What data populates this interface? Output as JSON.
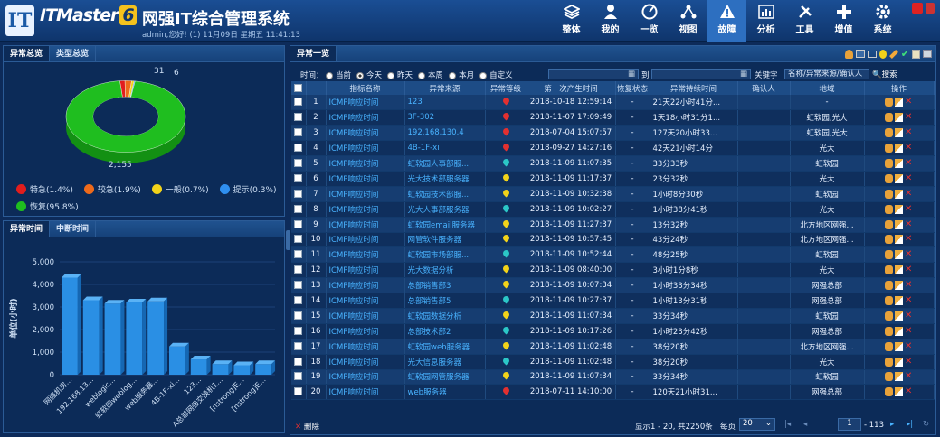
{
  "header": {
    "logo_letter": "IT",
    "brand": "ITMaster",
    "brand_num": "6",
    "title": "网强IT综合管理系统",
    "user_info": "admin,您好! (1) 11月09日 星期五 11:41:13",
    "nav": [
      {
        "label": "整体",
        "icon": "layers-icon"
      },
      {
        "label": "我的",
        "icon": "user-icon"
      },
      {
        "label": "一览",
        "icon": "dashboard-icon"
      },
      {
        "label": "视图",
        "icon": "topology-icon"
      },
      {
        "label": "故障",
        "icon": "warning-icon",
        "active": true
      },
      {
        "label": "分析",
        "icon": "chart-icon"
      },
      {
        "label": "工具",
        "icon": "tools-icon"
      },
      {
        "label": "增值",
        "icon": "plus-icon"
      },
      {
        "label": "系统",
        "icon": "gear-icon"
      }
    ]
  },
  "left_top": {
    "tabs": [
      "异常总览",
      "类型总览"
    ],
    "chart_data": {
      "type": "pie",
      "labels": [
        "特急",
        "较急",
        "一般",
        "提示",
        "恢复"
      ],
      "values": [
        31,
        40,
        15,
        6,
        2155
      ],
      "data_labels": [
        "31",
        "6",
        "2,155"
      ],
      "colors": [
        "#e11d1d",
        "#ee6a1b",
        "#f2d31a",
        "#2f8ff0",
        "#1fbe1f"
      ],
      "legend": [
        "特急(1.4%)",
        "较急(1.9%)",
        "一般(0.7%)",
        "提示(0.3%)",
        "恢复(95.8%)"
      ]
    }
  },
  "left_bottom": {
    "tabs": [
      "异常时间",
      "中断时间"
    ],
    "chart_data": {
      "type": "bar",
      "ylabel": "单位(小时)",
      "ylim": [
        0,
        5000
      ],
      "yticks": [
        "0",
        "1,000",
        "2,000",
        "3,000",
        "4,000",
        "5,000"
      ],
      "categories": [
        "网强机房...",
        "192.168.13...",
        "weblogic...",
        "虹软园weblog...",
        "web服务器...",
        "4B-1F-xi...",
        "123...",
        "A总部网强交换机1...",
        "[nstrong]E...",
        "[nstrong]E..."
      ],
      "values": [
        4300,
        3300,
        3150,
        3200,
        3250,
        1250,
        680,
        470,
        420,
        470
      ],
      "color": "#2a8fe4"
    }
  },
  "right": {
    "tab": "异常一览",
    "filter": {
      "time_label": "时间：",
      "options": [
        "当前",
        "今天",
        "昨天",
        "本周",
        "本月",
        "自定义"
      ],
      "selected": "今天",
      "to_label": "到",
      "keyword_label": "关键字",
      "keyword_placeholder": "名称/异常来源/确认人",
      "search_label": "搜索"
    },
    "columns": [
      "",
      "",
      "指标名称",
      "异常来源",
      "异常等级",
      "第一次产生时间",
      "恢复状态",
      "异常持续时间",
      "确认人",
      "地域",
      "操作"
    ],
    "rows": [
      {
        "no": "1",
        "name": "ICMP响应时间",
        "src": "123",
        "level": "red",
        "time": "2018-10-18 12:59:14",
        "status": "-",
        "dur": "21天22小时41分...",
        "confirm": "",
        "region": "-"
      },
      {
        "no": "2",
        "name": "ICMP响应时间",
        "src": "3F-302",
        "level": "red",
        "time": "2018-11-07 17:09:49",
        "status": "-",
        "dur": "1天18小时31分1...",
        "confirm": "",
        "region": "虹软园,光大"
      },
      {
        "no": "3",
        "name": "ICMP响应时间",
        "src": "192.168.130.4",
        "level": "red",
        "time": "2018-07-04 15:07:57",
        "status": "-",
        "dur": "127天20小时33...",
        "confirm": "",
        "region": "虹软园,光大"
      },
      {
        "no": "4",
        "name": "ICMP响应时间",
        "src": "4B-1F-xi",
        "level": "red",
        "time": "2018-09-27 14:27:16",
        "status": "-",
        "dur": "42天21小时14分",
        "confirm": "",
        "region": "光大"
      },
      {
        "no": "5",
        "name": "ICMP响应时间",
        "src": "虹软园人事部服...",
        "level": "teal",
        "time": "2018-11-09 11:07:35",
        "status": "-",
        "dur": "33分33秒",
        "confirm": "",
        "region": "虹软园"
      },
      {
        "no": "6",
        "name": "ICMP响应时间",
        "src": "光大技术部服务器",
        "level": "yellow",
        "time": "2018-11-09 11:17:37",
        "status": "-",
        "dur": "23分32秒",
        "confirm": "",
        "region": "光大"
      },
      {
        "no": "7",
        "name": "ICMP响应时间",
        "src": "虹软园技术部服...",
        "level": "yellow",
        "time": "2018-11-09 10:32:38",
        "status": "-",
        "dur": "1小时8分30秒",
        "confirm": "",
        "region": "虹软园"
      },
      {
        "no": "8",
        "name": "ICMP响应时间",
        "src": "光大人事部服务器",
        "level": "teal",
        "time": "2018-11-09 10:02:27",
        "status": "-",
        "dur": "1小时38分41秒",
        "confirm": "",
        "region": "光大"
      },
      {
        "no": "9",
        "name": "ICMP响应时间",
        "src": "虹软园email服务器",
        "level": "yellow",
        "time": "2018-11-09 11:27:37",
        "status": "-",
        "dur": "13分32秒",
        "confirm": "",
        "region": "北方地区网强..."
      },
      {
        "no": "10",
        "name": "ICMP响应时间",
        "src": "网管软件服务器",
        "level": "yellow",
        "time": "2018-11-09 10:57:45",
        "status": "-",
        "dur": "43分24秒",
        "confirm": "",
        "region": "北方地区网强..."
      },
      {
        "no": "11",
        "name": "ICMP响应时间",
        "src": "虹软园市场部服...",
        "level": "teal",
        "time": "2018-11-09 10:52:44",
        "status": "-",
        "dur": "48分25秒",
        "confirm": "",
        "region": "虹软园"
      },
      {
        "no": "12",
        "name": "ICMP响应时间",
        "src": "光大数据分析",
        "level": "yellow",
        "time": "2018-11-09 08:40:00",
        "status": "-",
        "dur": "3小时1分8秒",
        "confirm": "",
        "region": "光大"
      },
      {
        "no": "13",
        "name": "ICMP响应时间",
        "src": "总部销售部3",
        "level": "yellow",
        "time": "2018-11-09 10:07:34",
        "status": "-",
        "dur": "1小时33分34秒",
        "confirm": "",
        "region": "网强总部"
      },
      {
        "no": "14",
        "name": "ICMP响应时间",
        "src": "总部销售部5",
        "level": "teal",
        "time": "2018-11-09 10:27:37",
        "status": "-",
        "dur": "1小时13分31秒",
        "confirm": "",
        "region": "网强总部"
      },
      {
        "no": "15",
        "name": "ICMP响应时间",
        "src": "虹软园数据分析",
        "level": "yellow",
        "time": "2018-11-09 11:07:34",
        "status": "-",
        "dur": "33分34秒",
        "confirm": "",
        "region": "虹软园"
      },
      {
        "no": "16",
        "name": "ICMP响应时间",
        "src": "总部技术部2",
        "level": "teal",
        "time": "2018-11-09 10:17:26",
        "status": "-",
        "dur": "1小时23分42秒",
        "confirm": "",
        "region": "网强总部"
      },
      {
        "no": "17",
        "name": "ICMP响应时间",
        "src": "虹软园web服务器",
        "level": "yellow",
        "time": "2018-11-09 11:02:48",
        "status": "-",
        "dur": "38分20秒",
        "confirm": "",
        "region": "北方地区网强..."
      },
      {
        "no": "18",
        "name": "ICMP响应时间",
        "src": "光大信息服务器",
        "level": "teal",
        "time": "2018-11-09 11:02:48",
        "status": "-",
        "dur": "38分20秒",
        "confirm": "",
        "region": "光大"
      },
      {
        "no": "19",
        "name": "ICMP响应时间",
        "src": "虹软园网管服务器",
        "level": "yellow",
        "time": "2018-11-09 11:07:34",
        "status": "-",
        "dur": "33分34秒",
        "confirm": "",
        "region": "虹软园"
      },
      {
        "no": "20",
        "name": "ICMP响应时间",
        "src": "web服务器",
        "level": "red",
        "time": "2018-07-11 14:10:00",
        "status": "-",
        "dur": "120天21小时31...",
        "confirm": "",
        "region": "网强总部"
      }
    ],
    "footer": {
      "delete_label": "删除",
      "summary": "显示1 - 20, 共2250条",
      "per_page_label": "每页",
      "per_page": "20",
      "page_input": "1",
      "page_total": "- 113"
    }
  },
  "colors": {
    "red": "#e23030",
    "yellow": "#f2d31a",
    "teal": "#2bc7c7"
  }
}
